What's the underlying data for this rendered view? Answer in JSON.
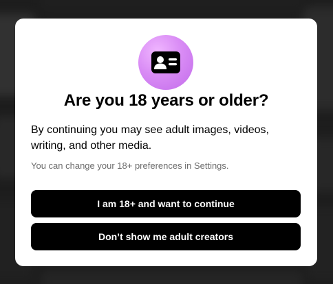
{
  "colors": {
    "badge_gradient_light": "#f0b6ff",
    "badge_gradient_dark": "#c26bea",
    "button_bg": "#000000",
    "button_text": "#ffffff",
    "note_text": "#6b6b6b"
  },
  "dialog": {
    "icon": "id-card-icon",
    "title": "Are you 18 years or older?",
    "body": "By continuing you may see adult images, videos, writing, and other media.",
    "note": "You can change your 18+ preferences in Settings.",
    "continue_label": "I am 18+ and want to continue",
    "decline_label": "Don’t show me adult creators"
  }
}
